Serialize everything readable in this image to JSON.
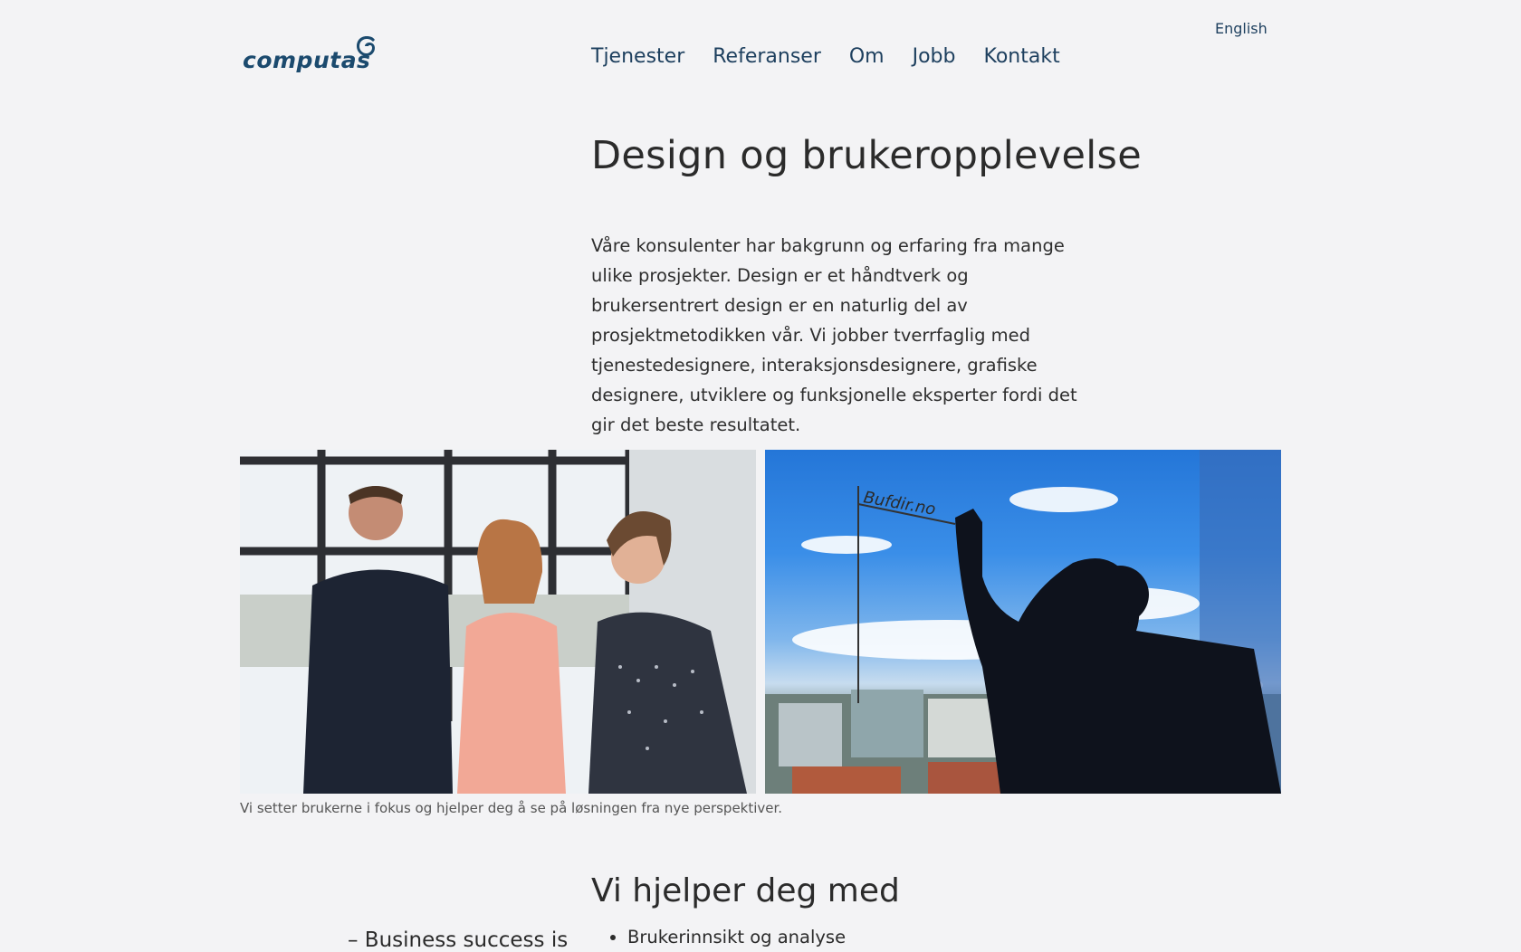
{
  "header": {
    "language_link": "English",
    "logo_text": "computas",
    "nav": [
      "Tjenester",
      "Referanser",
      "Om",
      "Jobb",
      "Kontakt"
    ]
  },
  "main": {
    "title": "Design og brukeropplevelse",
    "intro": "Våre konsulenter har bakgrunn og erfaring fra mange ulike prosjekter. Design er et håndtverk og brukersentrert design er en naturlig del av prosjektmetodikken vår. Vi jobber tverrfaglig med tjenestedesignere, interaksjonsdesignere, grafiske designere, utviklere og funksjonelle eksperter fordi det gir det beste resultatet.",
    "images": {
      "photo1": "team-photo",
      "photo2": "whiteboard-window-photo",
      "whiteboard_text": "Bufdir.no"
    },
    "caption": "Vi setter brukerne i fokus og hjelper deg å se på løsningen fra nye perspektiver.",
    "section_title": "Vi hjelper deg med",
    "quote_fragment": "– Business success is",
    "help_items": [
      "Brukerinnsikt og analyse"
    ]
  },
  "colors": {
    "background": "#f3f3f5",
    "brand": "#1b4a6e",
    "nav": "#1d3f5e",
    "text": "#2b2b2b"
  }
}
